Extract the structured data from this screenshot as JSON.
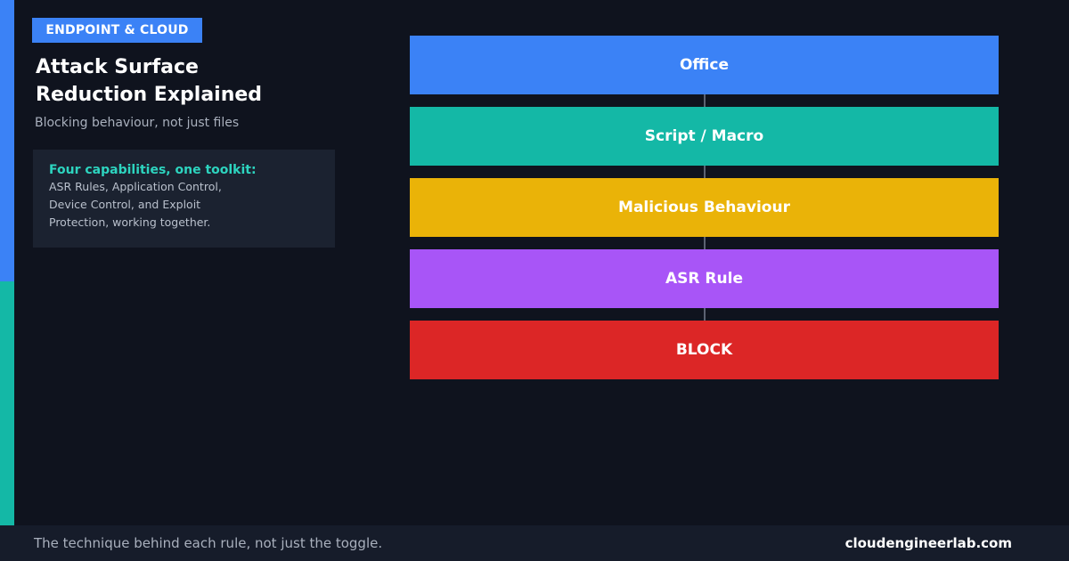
{
  "badge": "ENDPOINT & CLOUD",
  "title_lines": [
    "Attack Surface",
    "Reduction Explained"
  ],
  "subtitle": "Blocking behaviour, not just files",
  "info_card": {
    "heading": "Four capabilities, one toolkit:",
    "lines": [
      "ASR Rules, Application Control,",
      "Device Control, and Exploit",
      "Protection, working together."
    ]
  },
  "flow": {
    "steps": [
      {
        "label": "Office",
        "color": "#3b82f6"
      },
      {
        "label": "Script / Macro",
        "color": "#14b8a6"
      },
      {
        "label": "Malicious Behaviour",
        "color": "#eab308"
      },
      {
        "label": "ASR Rule",
        "color": "#a855f7"
      },
      {
        "label": "BLOCK",
        "color": "#dc2626"
      }
    ]
  },
  "footer": {
    "tagline": "The technique behind each rule, not just the toggle.",
    "site": "cloudengineerlab.com"
  },
  "colors": {
    "background": "#0f131e",
    "accent_blue": "#3b82f6",
    "accent_teal": "#14b8a6",
    "card_heading": "#2dd4bf"
  }
}
